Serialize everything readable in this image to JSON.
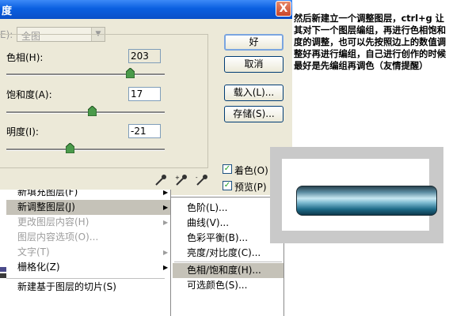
{
  "dialog": {
    "title": "度",
    "close_glyph": "X",
    "edit_label": "E):",
    "edit_value": "全图",
    "hue": {
      "label": "色相(H):",
      "value": "203",
      "level": 0.78
    },
    "saturation": {
      "label": "饱和度(A):",
      "value": "17",
      "level": 0.54
    },
    "lightness": {
      "label": "明度(I):",
      "value": "-21",
      "level": 0.4
    },
    "buttons": {
      "ok": "好",
      "cancel": "取消",
      "load": "载入(L)...",
      "save": "存储(S)..."
    },
    "colorize": {
      "label": "着色(O)",
      "checked": true
    },
    "preview": {
      "label": "预览(P)",
      "checked": true
    }
  },
  "tip_text": "然后新建立一个调整图层，ctrl+g 让其对下一个图层编组，再进行色相饱和度的调整，也可以先按照边上的数值调整好再进行编组，自己进行创作的时候最好是先编组再调色（友情提醒）",
  "menu": {
    "items": [
      {
        "label": "新填充图层(F)",
        "disabled": false,
        "submenu": true
      },
      {
        "label": "新调整图层(J)",
        "disabled": false,
        "submenu": true,
        "highlighted": true
      },
      {
        "label": "更改图层内容(H)",
        "disabled": true,
        "submenu": true
      },
      {
        "label": "图层内容选项(O)...",
        "disabled": true,
        "submenu": false
      },
      {
        "label": "文字(T)",
        "disabled": true,
        "submenu": true
      },
      {
        "label": "栅格化(Z)",
        "disabled": false,
        "submenu": true
      },
      {
        "label": "新建基于图层的切片(S)",
        "disabled": false,
        "submenu": false
      }
    ],
    "submenu": [
      {
        "label": "色阶(L)..."
      },
      {
        "label": "曲线(V)..."
      },
      {
        "label": "色彩平衡(B)..."
      },
      {
        "label": "亮度/对比度(C)..."
      },
      {
        "label": "色相/饱和度(H)...",
        "highlighted": true
      },
      {
        "label": "可选颜色(S)..."
      }
    ]
  },
  "colors": {
    "title_bar": "#0a5fe0",
    "dialog_bg": "#ece9d8",
    "menu_highlight": "#c5c2b8",
    "preview_bar": "#5a8aa0"
  },
  "icons": [
    "close-icon",
    "dropdown-arrow-icon",
    "slider-thumb-icon",
    "eyedropper-icon",
    "eyedropper-plus-icon",
    "eyedropper-minus-icon",
    "submenu-arrow-icon",
    "checkmark-icon"
  ]
}
